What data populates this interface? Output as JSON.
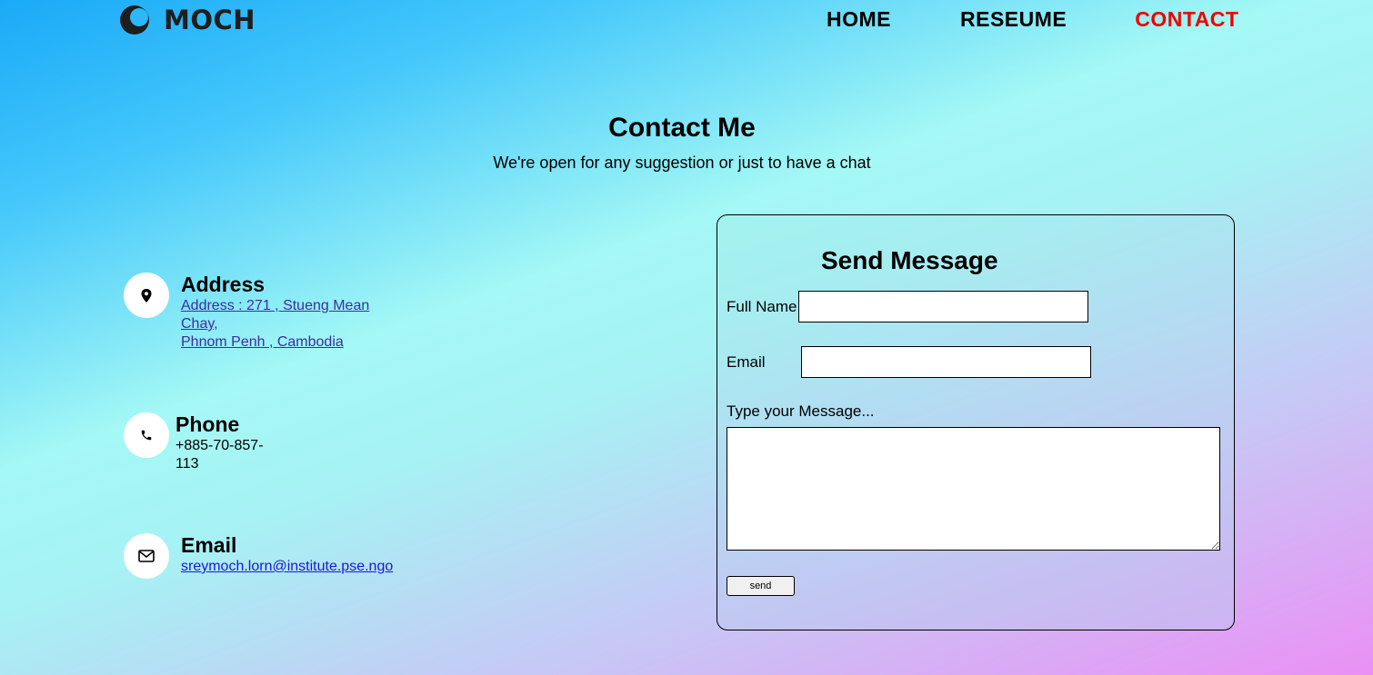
{
  "header": {
    "logo_text": "MOCH",
    "nav": [
      {
        "label": "HOME"
      },
      {
        "label": "RESEUME"
      },
      {
        "label": "CONTACT",
        "active": true
      }
    ],
    "active_color": "#f00000"
  },
  "hero": {
    "title": "Contact Me",
    "subtitle": "We're open for any suggestion or just to have a chat"
  },
  "contacts": {
    "address": {
      "icon": "map-pin-icon",
      "title": "Address",
      "line1": "Address : 271 , Stueng Mean",
      "line2": "Chay,",
      "line3": "Phnom Penh , Cambodia"
    },
    "phone": {
      "icon": "phone-icon",
      "title": "Phone",
      "line1": "+885-70-857-",
      "line2": "113"
    },
    "email": {
      "icon": "envelope-icon",
      "title": "Email",
      "value": "sreymoch.lorn@institute.pse.ngo"
    }
  },
  "form": {
    "title": "Send Message",
    "full_name_label": "Full Name",
    "full_name_value": "",
    "email_label": "Email",
    "email_value": "",
    "message_label": "Type your Message...",
    "message_value": "",
    "send_label": "send"
  }
}
